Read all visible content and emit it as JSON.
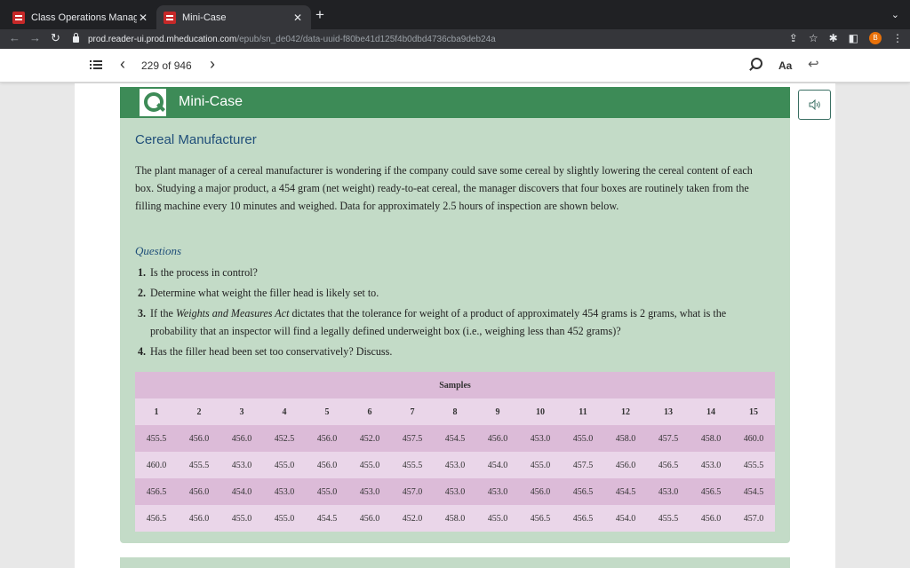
{
  "browser": {
    "tabs": [
      {
        "title": "Class Operations Management",
        "active": false
      },
      {
        "title": "Mini-Case",
        "active": true
      }
    ],
    "url_host": "prod.reader-ui.prod.mheducation.com",
    "url_path": "/epub/sn_de042/data-uuid-f80be41d125f4b0dbd4736cba9deb24a",
    "profile_initial": "B"
  },
  "reader": {
    "page_count": "229 of 946",
    "font_button": "Aa"
  },
  "case": {
    "header": "Mini-Case",
    "title": "Cereal Manufacturer",
    "body": "The plant manager of a cereal manufacturer is wondering if the company could save some cereal by slightly lowering the cereal content of each box. Studying a major product, a 454 gram (net weight) ready-to-eat cereal, the manager discovers that four boxes are routinely taken from the filling machine every 10 minutes and weighed. Data for approximately 2.5 hours of inspection are shown below.",
    "questions_heading": "Questions",
    "questions": [
      {
        "num": "1.",
        "text": "Is the process in control?"
      },
      {
        "num": "2.",
        "text": "Determine what weight the filler head is likely set to."
      },
      {
        "num": "3.",
        "text_before": "If the ",
        "text_italic": "Weights and Measures Act",
        "text_after": " dictates that the tolerance for weight of a product of approximately 454 grams is 2 grams, what is the probability that an inspector will find a legally defined underweight box (i.e., weighing less than 452 grams)?"
      },
      {
        "num": "4.",
        "text": "Has the filler head been set too conservatively? Discuss."
      }
    ],
    "table": {
      "caption": "Samples",
      "columns": [
        "1",
        "2",
        "3",
        "4",
        "5",
        "6",
        "7",
        "8",
        "9",
        "10",
        "11",
        "12",
        "13",
        "14",
        "15"
      ],
      "rows": [
        [
          "455.5",
          "456.0",
          "456.0",
          "452.5",
          "456.0",
          "452.0",
          "457.5",
          "454.5",
          "456.0",
          "453.0",
          "455.0",
          "458.0",
          "457.5",
          "458.0",
          "460.0"
        ],
        [
          "460.0",
          "455.5",
          "453.0",
          "455.0",
          "456.0",
          "455.0",
          "455.5",
          "453.0",
          "454.0",
          "455.0",
          "457.5",
          "456.0",
          "456.5",
          "453.0",
          "455.5"
        ],
        [
          "456.5",
          "456.0",
          "454.0",
          "453.0",
          "455.0",
          "453.0",
          "457.0",
          "453.0",
          "453.0",
          "456.0",
          "456.5",
          "454.5",
          "453.0",
          "456.5",
          "454.5"
        ],
        [
          "456.5",
          "456.0",
          "455.0",
          "455.0",
          "454.5",
          "456.0",
          "452.0",
          "458.0",
          "455.0",
          "456.5",
          "456.5",
          "454.0",
          "455.5",
          "456.0",
          "457.0"
        ]
      ]
    }
  },
  "colors": {
    "header_green": "#3d8b57",
    "box_green": "#c3dbc7",
    "title_blue": "#1f4e79",
    "table_dark": "#dcbbd8",
    "table_light": "#ead6e9"
  }
}
